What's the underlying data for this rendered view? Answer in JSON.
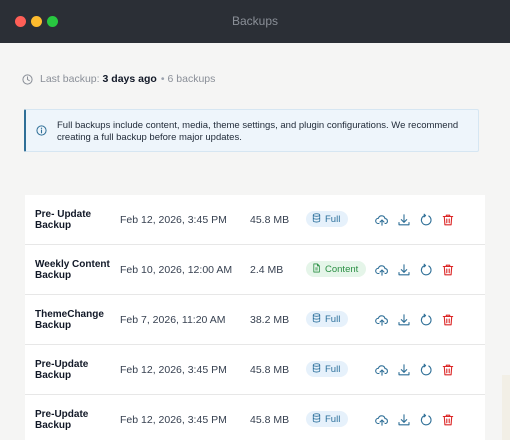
{
  "window": {
    "title": "Backups"
  },
  "status": {
    "prefix": "Last backup:",
    "last": "3 days ago",
    "separator": "•",
    "count": "6 backups"
  },
  "notice": {
    "text": "Full backups include content, media, theme settings, and plugin configurations. We recommend creating a full backup before major updates."
  },
  "icons": {
    "status": "clock-icon",
    "notice": "info-icon",
    "badge_full": "database-icon",
    "badge_content": "document-icon",
    "actions": [
      "upload-icon",
      "download-icon",
      "restore-icon",
      "trash-icon"
    ]
  },
  "colors": {
    "accent": "#2f6f97",
    "delete": "#dc2626",
    "full_badge": "#2a6f9b",
    "content_badge": "#2a8f43"
  },
  "backups": [
    {
      "name": "Pre- Update Backup",
      "date": "Feb 12, 2026, 3:45 PM",
      "size": "45.8 MB",
      "type": "Full"
    },
    {
      "name": "Weekly Content Backup",
      "date": "Feb 10, 2026, 12:00 AM",
      "size": "2.4 MB",
      "type": "Content"
    },
    {
      "name": "ThemeChange Backup",
      "date": "Feb 7, 2026, 11:20 AM",
      "size": "38.2 MB",
      "type": "Full"
    },
    {
      "name": "Pre-Update Backup",
      "date": "Feb 12, 2026, 3:45 PM",
      "size": "45.8 MB",
      "type": "Full"
    },
    {
      "name": "Pre-Update Backup",
      "date": "Feb 12, 2026, 3:45 PM",
      "size": "45.8 MB",
      "type": "Full"
    }
  ]
}
